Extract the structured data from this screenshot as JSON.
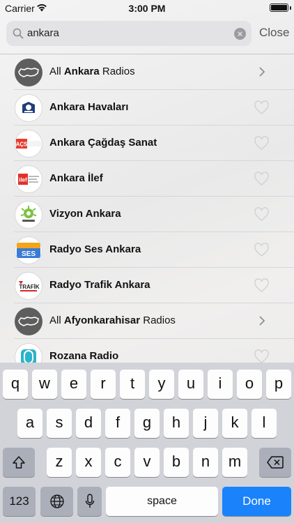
{
  "status_bar": {
    "carrier": "Carrier",
    "time": "3:00 PM"
  },
  "search": {
    "value": "ankara",
    "close_label": "Close"
  },
  "results": [
    {
      "type": "city",
      "prefix": "All ",
      "bold": "Ankara",
      "suffix": " Radios",
      "icon": "turkey-map-icon"
    },
    {
      "type": "station",
      "name": "Ankara Havaları",
      "logo": "ankara-havalari-logo"
    },
    {
      "type": "station",
      "name": "Ankara Çağdaş Sanat",
      "logo": "acs-radyosu-logo"
    },
    {
      "type": "station",
      "name": "Ankara İlef",
      "logo": "ilef-logo"
    },
    {
      "type": "station",
      "name": "Vizyon Ankara",
      "logo": "vizyon-logo"
    },
    {
      "type": "station",
      "name": "Radyo Ses Ankara",
      "logo": "radyo-ses-logo"
    },
    {
      "type": "station",
      "name": "Radyo Trafik Ankara",
      "logo": "radyo-trafik-logo"
    },
    {
      "type": "city",
      "prefix": "All ",
      "bold": "Afyonkarahisar",
      "suffix": " Radios",
      "icon": "turkey-map-icon"
    },
    {
      "type": "station",
      "name": "Rozana Radio",
      "logo": "rozana-logo"
    }
  ],
  "logo_text": {
    "acs": "AÇS",
    "ilef": "ilef",
    "trafik": "TRAFİK",
    "ses": "SES"
  },
  "keyboard": {
    "row1": [
      "q",
      "w",
      "e",
      "r",
      "t",
      "y",
      "u",
      "i",
      "o",
      "p"
    ],
    "row2": [
      "a",
      "s",
      "d",
      "f",
      "g",
      "h",
      "j",
      "k",
      "l"
    ],
    "row3": [
      "z",
      "x",
      "c",
      "v",
      "b",
      "n",
      "m"
    ],
    "numbers_label": "123",
    "space_label": "space",
    "done_label": "Done"
  },
  "colors": {
    "accent": "#1a82fb",
    "city_badge": "#5e5e5e",
    "keyboard_bg": "#d1d3d9"
  }
}
